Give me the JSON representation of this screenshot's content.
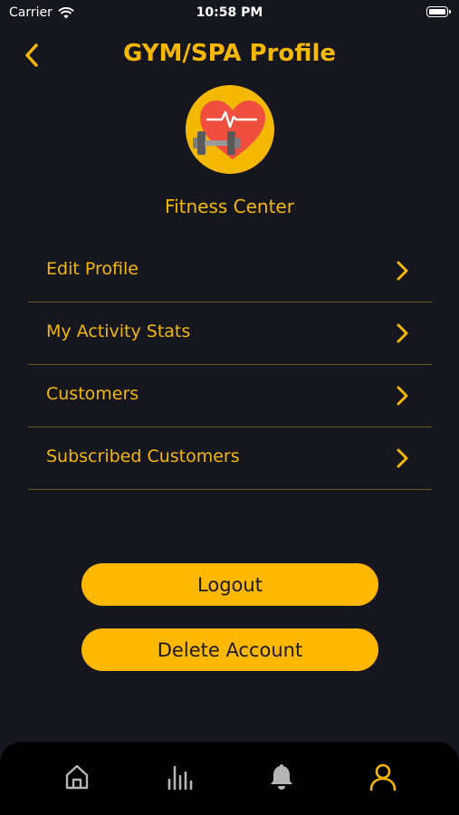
{
  "status_bar": {
    "carrier": "Carrier",
    "time": "10:58 PM"
  },
  "header": {
    "title": "GYM/SPA Profile",
    "back_icon": "chevron-left-icon"
  },
  "profile": {
    "name": "Fitness Center",
    "avatar_icon": "heart-dumbbell-icon"
  },
  "menu": {
    "items": [
      {
        "label": "Edit Profile"
      },
      {
        "label": "My Activity Stats"
      },
      {
        "label": "Customers"
      },
      {
        "label": "Subscribed Customers"
      }
    ]
  },
  "actions": {
    "logout_label": "Logout",
    "delete_label": "Delete Account"
  },
  "tab_bar": {
    "items": [
      {
        "icon": "home-icon",
        "active": false
      },
      {
        "icon": "bar-chart-icon",
        "active": false
      },
      {
        "icon": "bell-icon",
        "active": false
      },
      {
        "icon": "user-icon",
        "active": true
      }
    ]
  },
  "colors": {
    "accent": "#f5b800",
    "button": "#ffb800",
    "background": "#16161f",
    "tab_bar": "#000000",
    "inactive_icon": "#b5b5b5",
    "heart": "#f04e3e"
  }
}
